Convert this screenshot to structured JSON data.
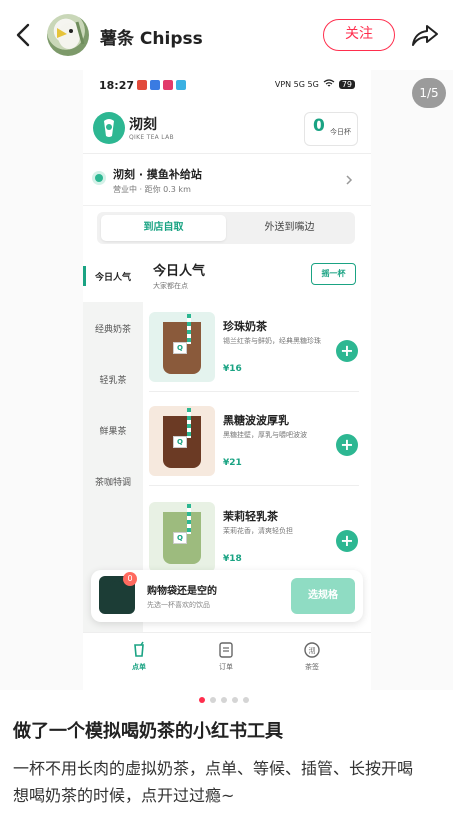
{
  "header": {
    "username": "薯条 Chipss",
    "follow_label": "关注"
  },
  "gallery": {
    "counter": "1/5",
    "total_dots": 5,
    "active_dot": 1
  },
  "phone_screen": {
    "status": {
      "time": "18:27",
      "network": "VPN 5G 5G",
      "battery": "79"
    },
    "brand": {
      "name": "沏刻",
      "subtitle": "QIKE TEA LAB",
      "cup_count": "0",
      "cup_label": "今日杯"
    },
    "store": {
      "name": "沏刻 · 摸鱼补给站",
      "meta": "营业中 · 距你 0.3 km"
    },
    "tabs": [
      "到店自取",
      "外送到嘴边"
    ],
    "categories": [
      "今日人气",
      "经典奶茶",
      "轻乳茶",
      "鲜果茶",
      "茶咖特调"
    ],
    "section": {
      "title": "今日人气",
      "subtitle": "大家都在点",
      "shake_label": "摇一杯"
    },
    "products": [
      {
        "name": "珍珠奶茶",
        "desc": "锡兰红茶与鲜奶，经典黑糖珍珠",
        "price": "¥16"
      },
      {
        "name": "黑糖波波厚乳",
        "desc": "黑糖挂壁，厚乳与嚼吧波波",
        "price": "¥21"
      },
      {
        "name": "茉莉轻乳茶",
        "desc": "茉莉花香，清爽轻负担",
        "price": "¥18"
      }
    ],
    "cart": {
      "badge": "0",
      "title": "购物袋还是空的",
      "subtitle": "先选一杯喜欢的饮品",
      "button": "选规格"
    },
    "nav": [
      {
        "label": "点单",
        "icon": "cup-icon"
      },
      {
        "label": "订单",
        "icon": "receipt-icon"
      },
      {
        "label": "茶签",
        "icon": "tea-tag-icon"
      }
    ]
  },
  "post": {
    "title": "做了一个模拟喝奶茶的小红书工具",
    "body_line1": "一杯不用长肉的虚拟奶茶，点单、等候、插管、长按开喝",
    "body_line2": "想喝奶茶的时候，点开过过瘾~"
  },
  "colors": {
    "accent_red": "#ff2e4d",
    "tea_green": "#2db792"
  }
}
